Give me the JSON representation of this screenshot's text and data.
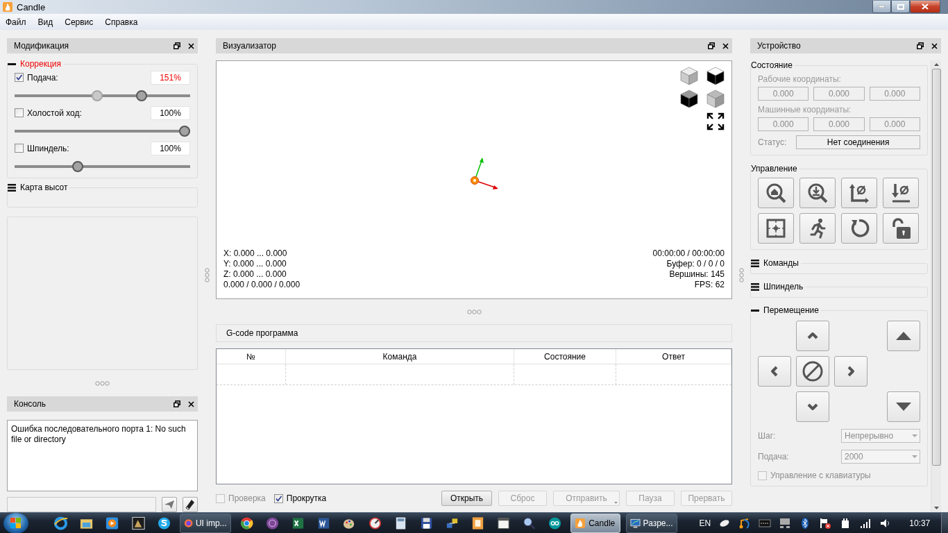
{
  "window": {
    "title": "Candle"
  },
  "menu": [
    "Файл",
    "Вид",
    "Сервис",
    "Справка"
  ],
  "modification": {
    "title": "Модификация",
    "correction": {
      "title": "Коррекция",
      "expanded": true,
      "active": true,
      "items": [
        {
          "label": "Подача:",
          "checked": true,
          "value": "151%",
          "overridden": true,
          "level": 0.74,
          "reference": {
            "level": 0.47
          }
        },
        {
          "label": "Холостой ход:",
          "checked": false,
          "value": "100%",
          "overridden": false,
          "level": 1.0
        },
        {
          "label": "Шпиндель:",
          "checked": false,
          "value": "100%",
          "overridden": false,
          "level": 0.35
        }
      ]
    },
    "height_map": {
      "title": "Карта высот",
      "expanded": false
    }
  },
  "console": {
    "title": "Консоль",
    "log": "Ошибка последовательного порта 1: No such file or directory"
  },
  "visualizer": {
    "title": "Визуализатор",
    "coords": [
      "X: 0.000 ... 0.000",
      "Y: 0.000 ... 0.000",
      "Z: 0.000 ... 0.000",
      "0.000 / 0.000 / 0.000"
    ],
    "stats": [
      "00:00:00 / 00:00:00",
      "Буфер: 0 / 0 / 0",
      "Вершины: 145",
      "FPS: 62"
    ]
  },
  "program": {
    "title": "G-code программа",
    "columns": [
      "№",
      "Команда",
      "Состояние",
      "Ответ"
    ],
    "options": [
      {
        "label": "Проверка",
        "checked": false,
        "disabled": true
      },
      {
        "label": "Прокрутка",
        "checked": true,
        "disabled": false
      }
    ],
    "buttons": [
      {
        "label": "Открыть",
        "disabled": false,
        "kind": "plain"
      },
      {
        "label": "Сброс",
        "disabled": true,
        "kind": "plain"
      },
      {
        "label": "Отправить",
        "disabled": true,
        "kind": "menu"
      },
      {
        "label": "Пауза",
        "disabled": true,
        "kind": "plain"
      },
      {
        "label": "Прервать",
        "disabled": true,
        "kind": "plain"
      }
    ]
  },
  "device": {
    "title": "Устройство",
    "state": {
      "title": "Состояние",
      "disabled": true,
      "work_label": "Рабочие координаты:",
      "work": [
        "0.000",
        "0.000",
        "0.000"
      ],
      "machine_label": "Машинные координаты:",
      "machine": [
        "0.000",
        "0.000",
        "0.000"
      ],
      "status_label": "Статус:",
      "status": "Нет соединения"
    },
    "control": {
      "title": "Управление"
    },
    "commands": {
      "title": "Команды",
      "expanded": false
    },
    "spindle": {
      "title": "Шпиндель",
      "expanded": false
    },
    "jog": {
      "title": "Перемещение",
      "expanded": true,
      "disabled": true,
      "step_label": "Шаг:",
      "step": "Непрерывно",
      "feed_label": "Подача:",
      "feed": "2000",
      "keyboard": {
        "label": "Управление с клавиатуры",
        "checked": false
      }
    }
  },
  "taskbar": {
    "windows": [
      {
        "label": "UI imp...",
        "selected": false
      },
      {
        "label": "Candle",
        "selected": true
      },
      {
        "label": "Разре...",
        "selected": false
      }
    ],
    "language": "EN",
    "clock": "10:37"
  }
}
